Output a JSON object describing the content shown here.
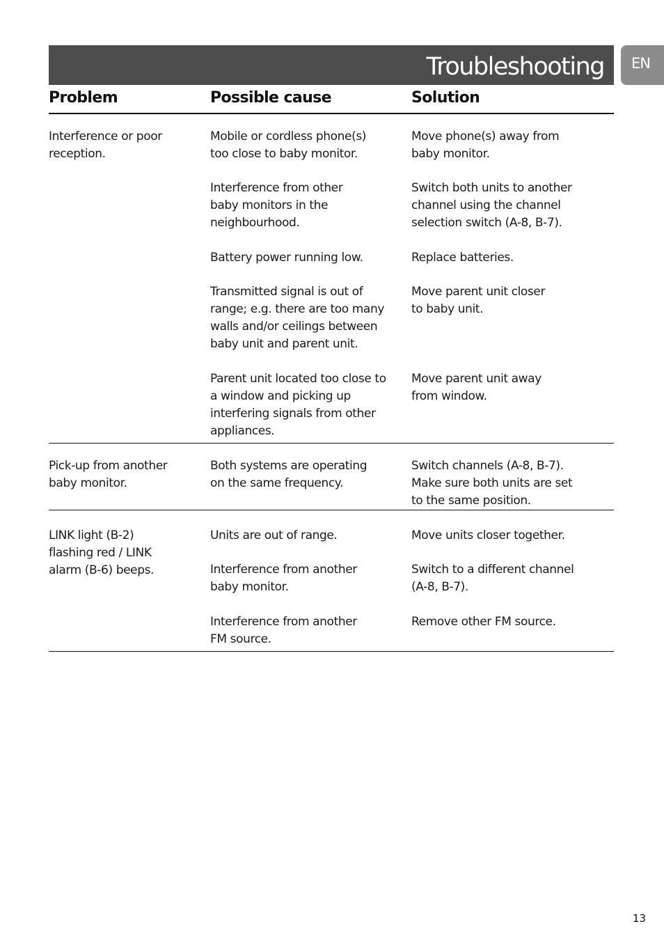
{
  "header": {
    "title": "Troubleshooting",
    "language_tab": "EN"
  },
  "table": {
    "columns": [
      "Problem",
      "Possible cause",
      "Solution"
    ],
    "groups": [
      {
        "problem": "Interference or poor\nreception.",
        "entries": [
          {
            "cause": "Mobile or cordless phone(s)\ntoo close to baby monitor.",
            "solution": "Move phone(s) away from\nbaby monitor."
          },
          {
            "cause": "Interference from other\nbaby monitors in the\nneighbourhood.",
            "solution": "Switch both units to another\nchannel using the channel\nselection switch (A-8, B-7)."
          },
          {
            "cause": "Battery power running low.",
            "solution": "Replace batteries."
          },
          {
            "cause": "Transmitted signal is out of\nrange; e.g. there are too many\nwalls and/or ceilings between\nbaby unit and parent unit.",
            "solution": "Move parent unit closer\nto baby unit."
          },
          {
            "cause": "Parent unit located too close to\na window and picking up\ninterfering signals from other\nappliances.",
            "solution": "Move parent unit away\nfrom window."
          }
        ]
      },
      {
        "problem": "Pick-up from another\nbaby monitor.",
        "entries": [
          {
            "cause": "Both systems are operating\non the same frequency.",
            "solution": "Switch channels (A-8, B-7).\nMake sure both units are set\nto the same position."
          }
        ]
      },
      {
        "problem": "LINK light (B-2)\nflashing red / LINK\nalarm (B-6) beeps.",
        "entries": [
          {
            "cause": "Units are out of range.",
            "solution": "Move units closer together."
          },
          {
            "cause": "Interference from another\nbaby monitor.",
            "solution": "Switch to a different channel\n(A-8, B-7)."
          },
          {
            "cause": "Interference from another\nFM source.",
            "solution": "Remove other FM source."
          }
        ]
      }
    ]
  },
  "footer": {
    "page_number": "13"
  }
}
